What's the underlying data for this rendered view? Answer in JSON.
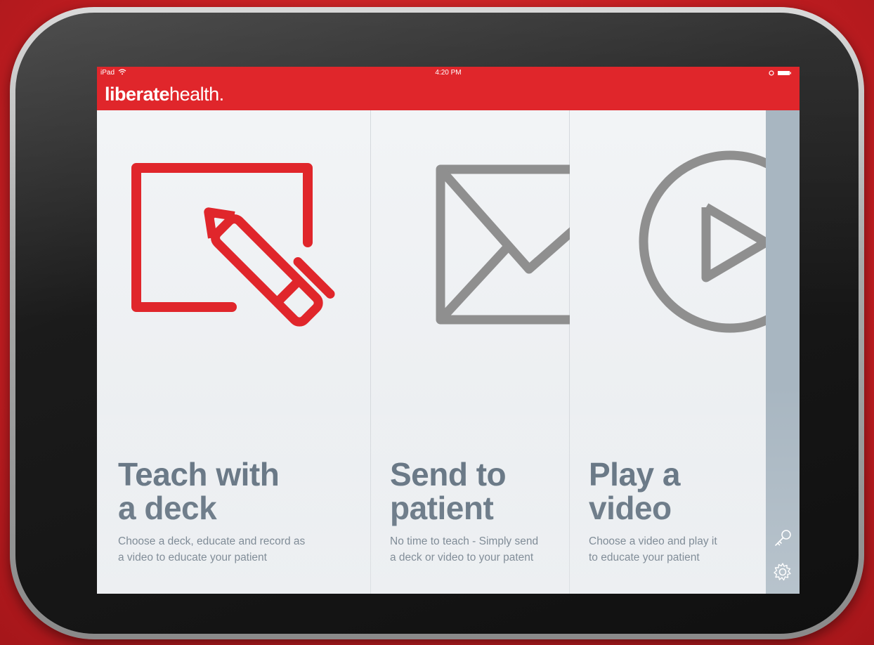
{
  "status_bar": {
    "device": "iPad",
    "time": "4:20 PM"
  },
  "brand": {
    "bold": "liberate",
    "light": "health."
  },
  "colors": {
    "brand_red": "#e0262b",
    "icon_gray": "#8f8f8f",
    "title_slate": "#5e6e7d",
    "sidebar": "#a8b6c1"
  },
  "cards": [
    {
      "icon": "pencil-on-canvas-icon",
      "title_line1": "Teach with",
      "title_line2": "a deck",
      "desc_line1": "Choose a deck, educate and record as",
      "desc_line2": "a video to educate your patient"
    },
    {
      "icon": "envelope-icon",
      "title_line1": "Send to",
      "title_line2": "patient",
      "desc_line1": "No time to teach - Simply send",
      "desc_line2": "a deck or video to your patent"
    },
    {
      "icon": "play-circle-icon",
      "title_line1": "Play a",
      "title_line2": "video",
      "desc_line1": "Choose a video and play it",
      "desc_line2": "to educate your patient"
    }
  ],
  "sidebar": {
    "tools": [
      "key-icon",
      "gear-icon"
    ]
  }
}
